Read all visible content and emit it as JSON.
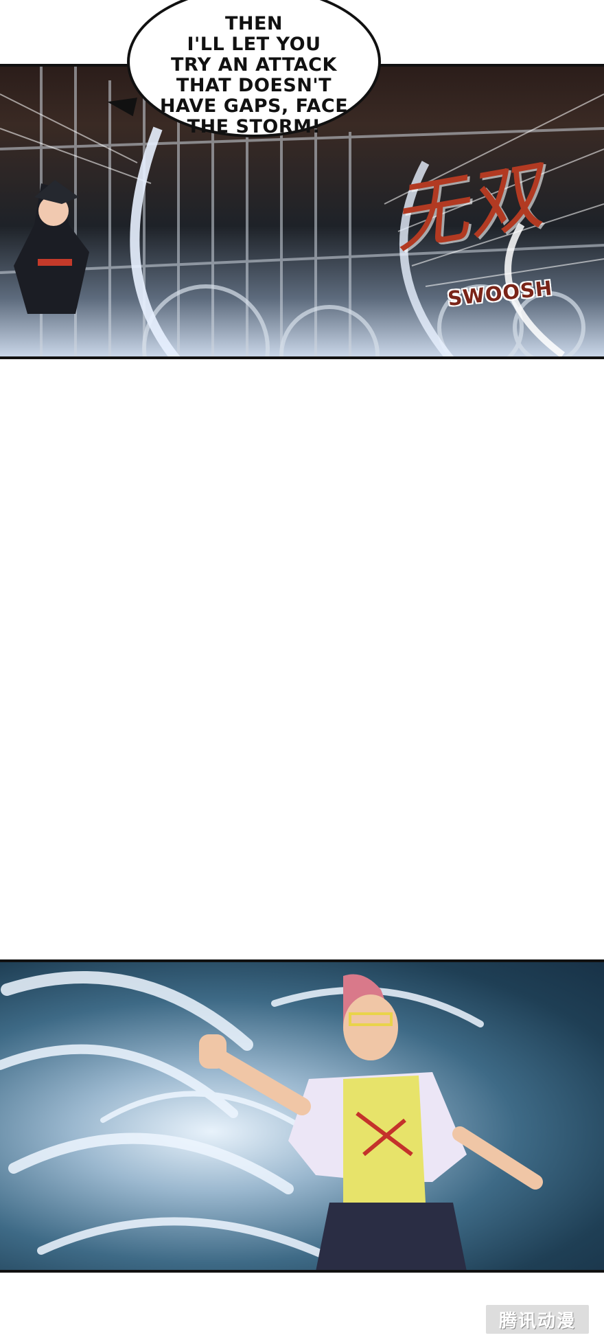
{
  "panel_top": {
    "speech": "THEN\nI'LL LET YOU\nTRY AN ATTACK\nTHAT DOESN'T\nHAVE GAPS, FACE\nTHE STORM!",
    "sfx": "SWOOSH",
    "sfx_cn": "无双"
  },
  "watermark": {
    "text": "腾讯动漫"
  }
}
